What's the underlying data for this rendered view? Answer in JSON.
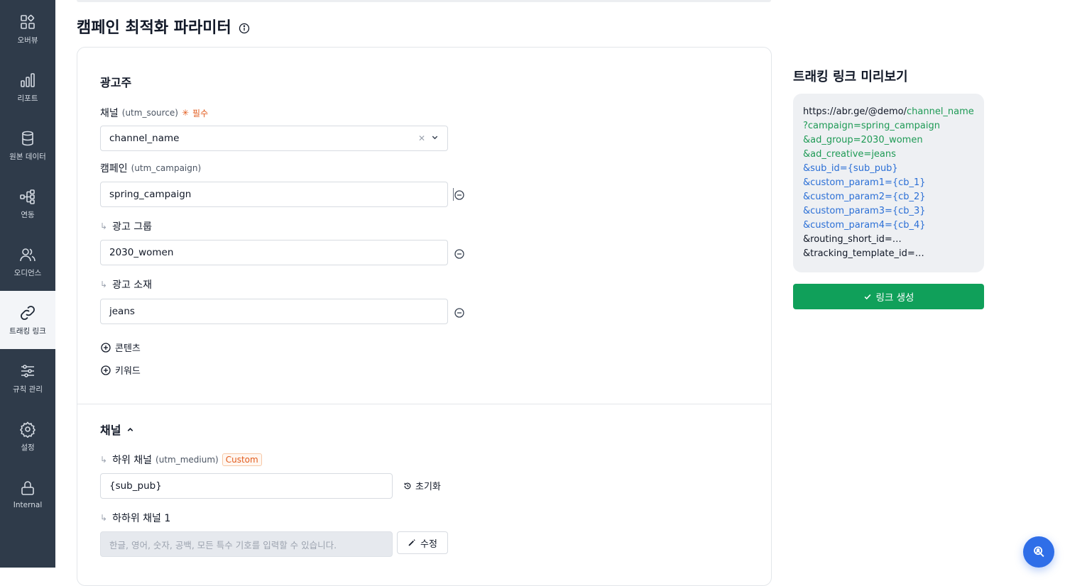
{
  "sidebar": {
    "items": [
      {
        "label": "오버뷰",
        "icon": "overview-icon"
      },
      {
        "label": "리포트",
        "icon": "report-chart-icon"
      },
      {
        "label": "원본 데이터",
        "icon": "database-icon"
      },
      {
        "label": "연동",
        "icon": "integration-icon"
      },
      {
        "label": "오디언스",
        "icon": "audience-icon"
      },
      {
        "label": "트래킹 링크",
        "icon": "link-icon",
        "active": true
      },
      {
        "label": "규칙 관리",
        "icon": "sliders-icon"
      },
      {
        "label": "설정",
        "icon": "gear-icon"
      },
      {
        "label": "Internal",
        "icon": "lock-icon"
      }
    ]
  },
  "page": {
    "title": "캠페인 최적화 파라미터",
    "title_icon": "info-icon"
  },
  "advertiser": {
    "section_title": "광고주",
    "channel_label": "채널",
    "channel_param": "(utm_source)",
    "required_label": "필수",
    "channel_value": "channel_name",
    "campaign_label": "캠페인",
    "campaign_param": "(utm_campaign)",
    "campaign_value": "spring_campaign",
    "ad_group_label": "광고 그룹",
    "ad_group_value": "2030_women",
    "ad_creative_label": "광고 소재",
    "ad_creative_value": "jeans",
    "add_content_label": "콘텐츠",
    "add_keyword_label": "키워드"
  },
  "channel": {
    "section_title": "채널",
    "sub_channel_label": "하위 채널",
    "sub_channel_param": "(utm_medium)",
    "custom_badge": "Custom",
    "sub_channel_value": "{sub_pub}",
    "reset_label": "초기화",
    "sub_sub_channel_label": "하하위 채널 1",
    "sub_sub_channel_placeholder": "한글, 영어, 숫자, 공백, 모든 특수 기호를 입력할 수 있습니다.",
    "edit_label": "수정"
  },
  "preview": {
    "title": "트래킹 링크 미리보기",
    "base_url": "https://abr.ge/@demo/",
    "channel_part": "channel_name",
    "lines_green": [
      "?campaign=spring_campaign",
      "&ad_group=2030_women",
      "&ad_creative=jeans"
    ],
    "lines_blue": [
      "&sub_id={sub_pub}",
      "&custom_param1={cb_1}",
      "&custom_param2={cb_2}",
      "&custom_param3={cb_3}",
      "&custom_param4={cb_4}"
    ],
    "lines_plain": [
      "&routing_short_id=…",
      "&tracking_template_id=…"
    ],
    "create_button": "링크 생성"
  },
  "colors": {
    "sidebar_bg": "#2f3b4a",
    "primary_green": "#10a05a",
    "link_green": "#1e9a55",
    "link_blue": "#2b6fd6",
    "required_orange": "#e25c1e",
    "fab_blue": "#2f6ee8"
  }
}
